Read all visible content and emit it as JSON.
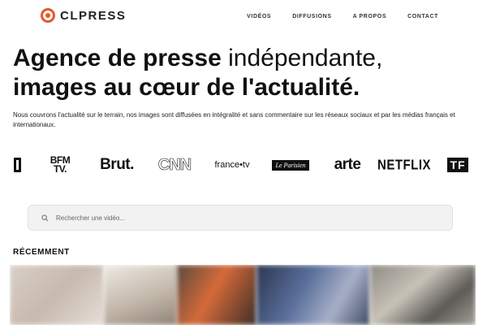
{
  "header": {
    "logo_text": "CLPRESS",
    "brand_color": "#e8562a",
    "nav": [
      {
        "label": "VIDÉOS"
      },
      {
        "label": "DIFFUSIONS"
      },
      {
        "label": "A PROPOS"
      },
      {
        "label": "CONTACT"
      }
    ]
  },
  "hero": {
    "line1_bold": "Agence de presse",
    "line1_light": "indépendante,",
    "line2_bold": "images au cœur de l'actualité.",
    "intro": "Nous couvrons l'actualité sur le terrain, nos images sont diffusées en intégralité et sans commentaire sur les réseaux sociaux et par les médias français et internationaux."
  },
  "clients": {
    "bfm_top": "BFM",
    "bfm_bottom": "TV.",
    "brut": "Brut.",
    "cnn": "CNN",
    "france_tv": "france•tv",
    "le_parisien": "Le Parisien",
    "arte": "arte",
    "netflix": "NETFLIX",
    "tf1": "TF"
  },
  "search": {
    "placeholder": "Rechercher une vidéo..."
  },
  "recent": {
    "title": "RÉCEMMENT"
  }
}
